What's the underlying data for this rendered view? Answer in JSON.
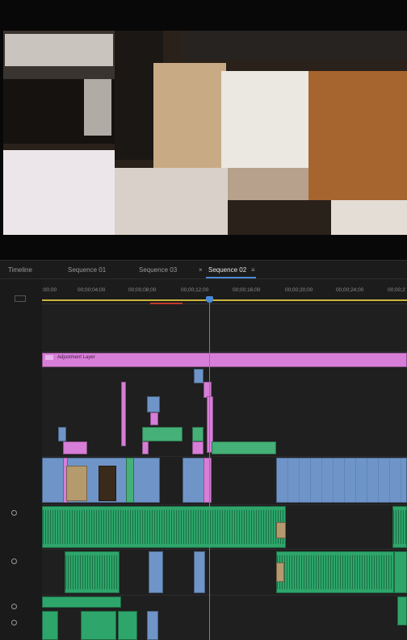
{
  "tabs": {
    "timeline": "Timeline",
    "seq1": "Sequence 01",
    "seq3": "Sequence 03",
    "seq2_close": "×",
    "seq2": "Sequence 02",
    "seq2_menu": "≡"
  },
  "ruler": {
    "t0": ":00;00",
    "t1": "00;00;04;00",
    "t2": "00;00;08;00",
    "t3": "00;00;12;00",
    "t4": "00;00;16;00",
    "t5": "00;00;20;00",
    "t6": "00;00;24;00",
    "t7": "00;00;2"
  },
  "clips": {
    "adjustment_layer": "Adjustment Layer"
  },
  "colors": {
    "accent": "#4b8ad8",
    "adjustment": "#d77ed8",
    "video_clip": "#6f95c8",
    "audio_clip": "#45b077"
  },
  "icons": [
    "fx-icon",
    "mic-icon",
    "playhead-icon",
    "timeline-settings-icon"
  ]
}
